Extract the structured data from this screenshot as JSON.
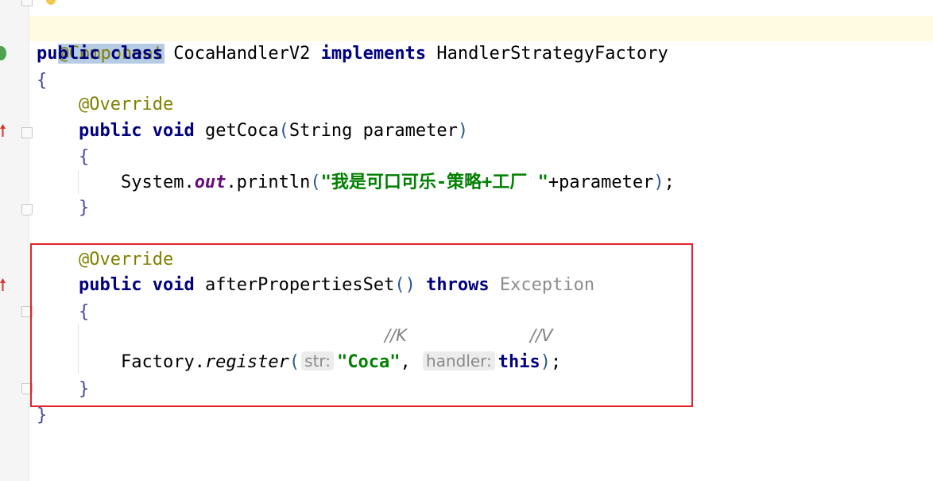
{
  "editor": {
    "lines": {
      "annotation_component": "@Component",
      "class_kw_public": "public",
      "class_kw_class": "class",
      "class_name": "CocaHandlerV2",
      "class_kw_implements": "implements",
      "class_interface": "HandlerStrategyFactory",
      "open_brace": "{",
      "override1": "@Override",
      "m1_public": "public",
      "m1_void": "void",
      "m1_name": "getCoca",
      "m1_lparen": "(",
      "m1_params": "String parameter",
      "m1_rparen": ")",
      "m1_open": "{",
      "println_system": "System.",
      "println_out": "out",
      "println_call": ".println",
      "println_lparen": "(",
      "println_string": "\"我是可口可乐-策略+工厂 \"",
      "println_rest": "+parameter",
      "println_rparen": ")",
      "println_semi": ";",
      "m1_close": "}",
      "override2": "@Override",
      "m2_public": "public",
      "m2_void": "void",
      "m2_name": "afterPropertiesSet",
      "m2_parens": "()",
      "m2_throws": "throws",
      "m2_exception": "Exception",
      "m2_open": "{",
      "comment_k": "//K",
      "comment_v": "//V",
      "register_factory": "Factory.",
      "register_method": "register",
      "register_lparen": "(",
      "hint_str": "str:",
      "register_string": "\"Coca\"",
      "register_comma": ",",
      "hint_handler": "handler:",
      "register_this": "this",
      "register_rparen": ")",
      "register_semi": ";",
      "m2_close": "}",
      "close_brace": "}"
    }
  },
  "colors": {
    "keyword": "#000080",
    "annotation": "#808000",
    "string": "#008000",
    "selection": "#b6cbe4",
    "highlight_box": "#e2222b",
    "current_line": "#fffbe3"
  },
  "icons": [
    "bulb-icon",
    "spring-bean-icon",
    "override-marker-icon",
    "fold-icon"
  ]
}
